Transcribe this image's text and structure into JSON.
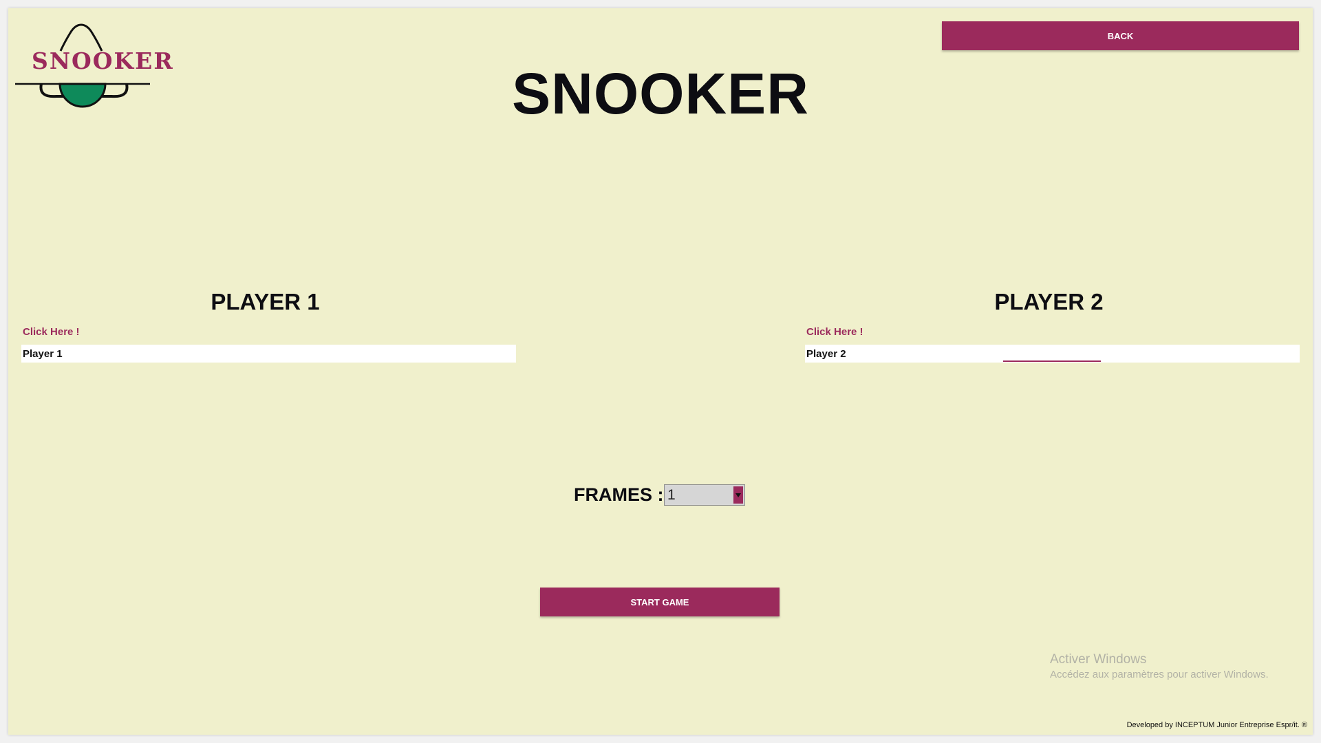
{
  "header": {
    "logo_text": "SNOOKER",
    "title": "SNOOKER",
    "back_label": "BACK"
  },
  "player1": {
    "title": "PLAYER 1",
    "click_label": "Click Here !",
    "value": "Player 1"
  },
  "player2": {
    "title": "PLAYER 2",
    "click_label": "Click Here !",
    "value": "Player 2"
  },
  "frames": {
    "label": "FRAMES :",
    "selected": "1"
  },
  "start_label": "START GAME",
  "watermark": {
    "title": "Activer Windows",
    "subtitle": "Accédez aux paramètres pour activer Windows."
  },
  "footer": "Developed by INCEPTUM Junior Entreprise Espr/it. ®",
  "colors": {
    "accent": "#9b2a5c",
    "background": "#f0f0cc",
    "ball": "#0e8a5a",
    "text": "#0d0d12"
  },
  "icons": {
    "frames_dropdown": "chevron-down-icon"
  }
}
